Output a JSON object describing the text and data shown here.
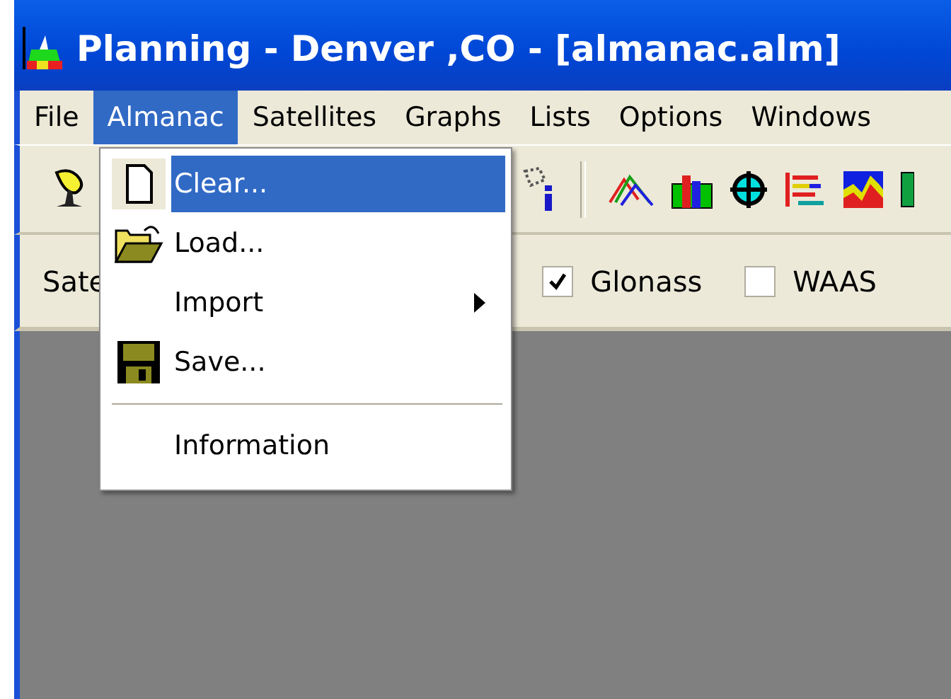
{
  "window": {
    "title": "Planning - Denver ,CO - [almanac.alm]"
  },
  "menu_bar": [
    {
      "label": "File",
      "selected": false
    },
    {
      "label": "Almanac",
      "selected": true
    },
    {
      "label": "Satellites",
      "selected": false
    },
    {
      "label": "Graphs",
      "selected": false
    },
    {
      "label": "Lists",
      "selected": false
    },
    {
      "label": "Options",
      "selected": false
    },
    {
      "label": "Windows",
      "selected": false
    }
  ],
  "filter_bar": {
    "label": "Sate",
    "checkboxes": [
      {
        "label": "Glonass",
        "checked": true
      },
      {
        "label": "WAAS",
        "checked": false
      }
    ]
  },
  "dropdown_menu": [
    {
      "kind": "item",
      "label": "Clear...",
      "selected": true,
      "submenu": false
    },
    {
      "kind": "item",
      "label": "Load...",
      "selected": false,
      "submenu": false
    },
    {
      "kind": "item",
      "label": "Import",
      "selected": false,
      "submenu": true
    },
    {
      "kind": "item",
      "label": "Save...",
      "selected": false,
      "submenu": false
    },
    {
      "kind": "separator"
    },
    {
      "kind": "item",
      "label": "Information",
      "selected": false,
      "submenu": false
    }
  ]
}
